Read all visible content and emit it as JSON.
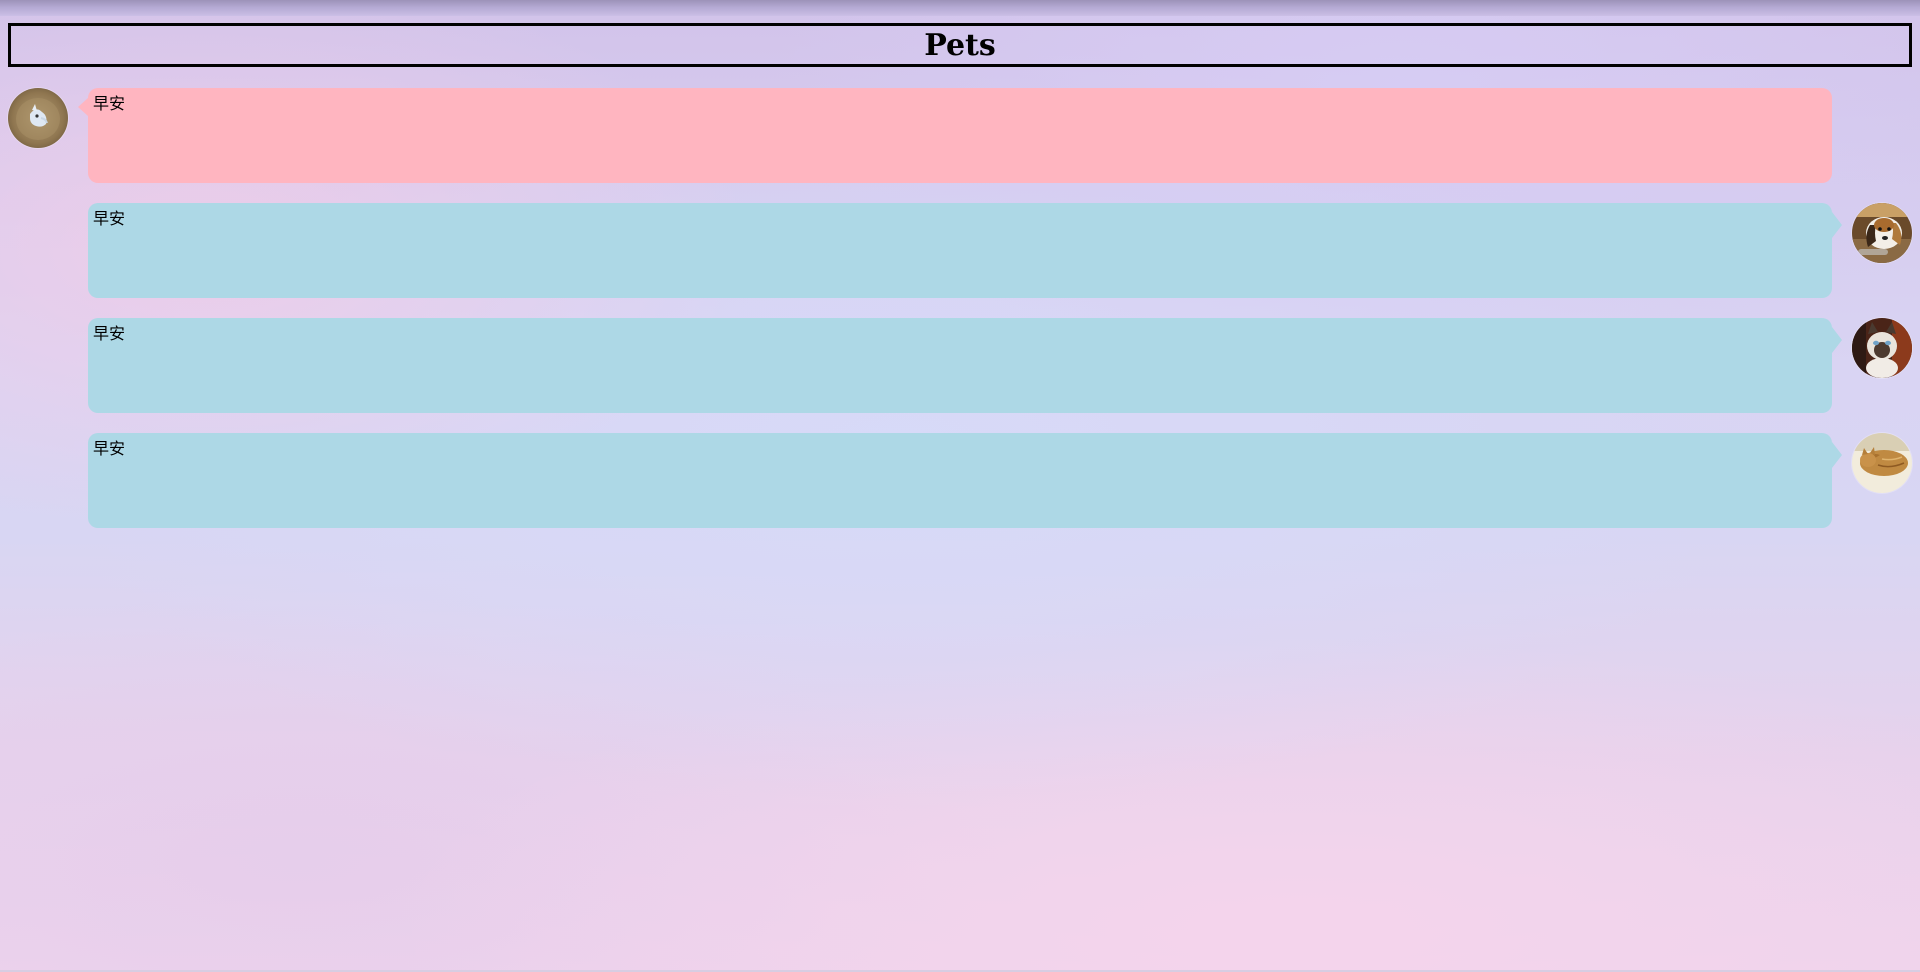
{
  "header": {
    "title": "Pets"
  },
  "messages": [
    {
      "side": "left",
      "text": "早安",
      "avatar_icon": "small-dog-photo-icon",
      "bubble_color": "#ffb5c0"
    },
    {
      "side": "right",
      "text": "早安",
      "avatar_icon": "beagle-dog-photo-icon",
      "bubble_color": "#add8e6"
    },
    {
      "side": "right",
      "text": "早安",
      "avatar_icon": "siamese-cat-photo-icon",
      "bubble_color": "#add8e6"
    },
    {
      "side": "right",
      "text": "早安",
      "avatar_icon": "sleeping-cat-photo-icon",
      "bubble_color": "#add8e6"
    }
  ],
  "colors": {
    "left_bubble": "#ffb5c0",
    "right_bubble": "#add8e6",
    "header_border": "#000000"
  }
}
